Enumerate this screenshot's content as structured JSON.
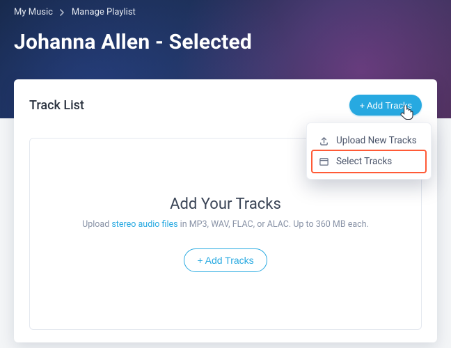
{
  "breadcrumb": {
    "root": "My Music",
    "current": "Manage Playlist"
  },
  "page": {
    "title": "Johanna Allen - Selected"
  },
  "card": {
    "title": "Track List",
    "add_button": "+ Add Tracks"
  },
  "menu": {
    "upload": "Upload New Tracks",
    "select": "Select Tracks"
  },
  "dropzone": {
    "heading": "Add Your Tracks",
    "pre": "Upload ",
    "link": "stereo audio files",
    "post": " in MP3, WAV, FLAC, or ALAC. Up to 360 MB each.",
    "button": "+ Add Tracks"
  }
}
